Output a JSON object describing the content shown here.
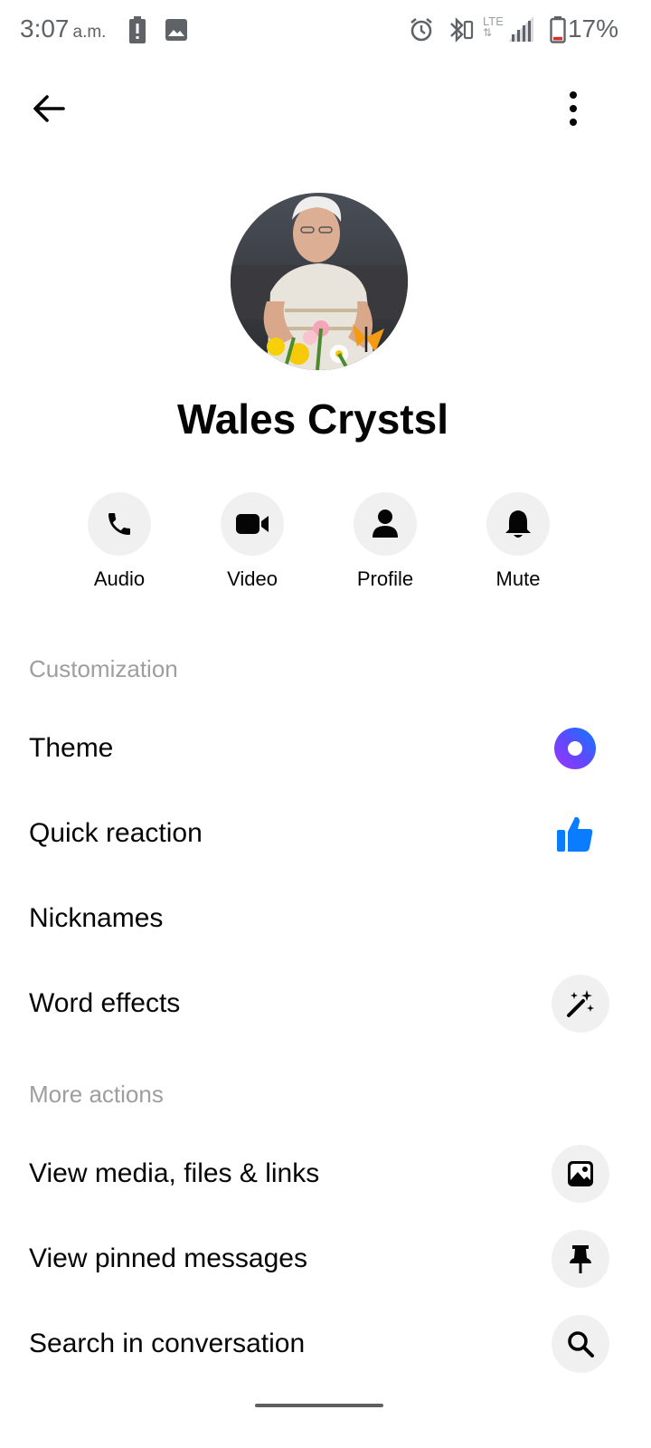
{
  "status_bar": {
    "time": "3:07",
    "ampm": "a.m.",
    "battery_percent": "17%",
    "network": "LTE",
    "battery_level": 0.17
  },
  "top_bar": {
    "back_icon": "arrow-left-icon",
    "more_icon": "more-vertical-icon"
  },
  "contact": {
    "name": "Wales Crystsl"
  },
  "actions": [
    {
      "label": "Audio",
      "icon": "phone-icon"
    },
    {
      "label": "Video",
      "icon": "video-camera-icon"
    },
    {
      "label": "Profile",
      "icon": "person-icon"
    },
    {
      "label": "Mute",
      "icon": "bell-icon"
    }
  ],
  "customization": {
    "title": "Customization",
    "items": [
      {
        "label": "Theme",
        "icon": "theme-gradient-icon"
      },
      {
        "label": "Quick reaction",
        "icon": "thumbs-up-icon"
      },
      {
        "label": "Nicknames"
      },
      {
        "label": "Word effects",
        "icon": "magic-wand-icon"
      }
    ]
  },
  "more_actions": {
    "title": "More actions",
    "items": [
      {
        "label": "View media, files & links",
        "icon": "image-icon"
      },
      {
        "label": "View pinned messages",
        "icon": "pin-icon"
      },
      {
        "label": "Search in conversation",
        "icon": "search-icon"
      }
    ]
  },
  "colors": {
    "accent_blue": "#0a7cff",
    "theme_gradient_start": "#0a7cff",
    "theme_gradient_end": "#a033ff",
    "section_grey": "#9e9e9e",
    "icon_bg": "#f0f0f0"
  }
}
